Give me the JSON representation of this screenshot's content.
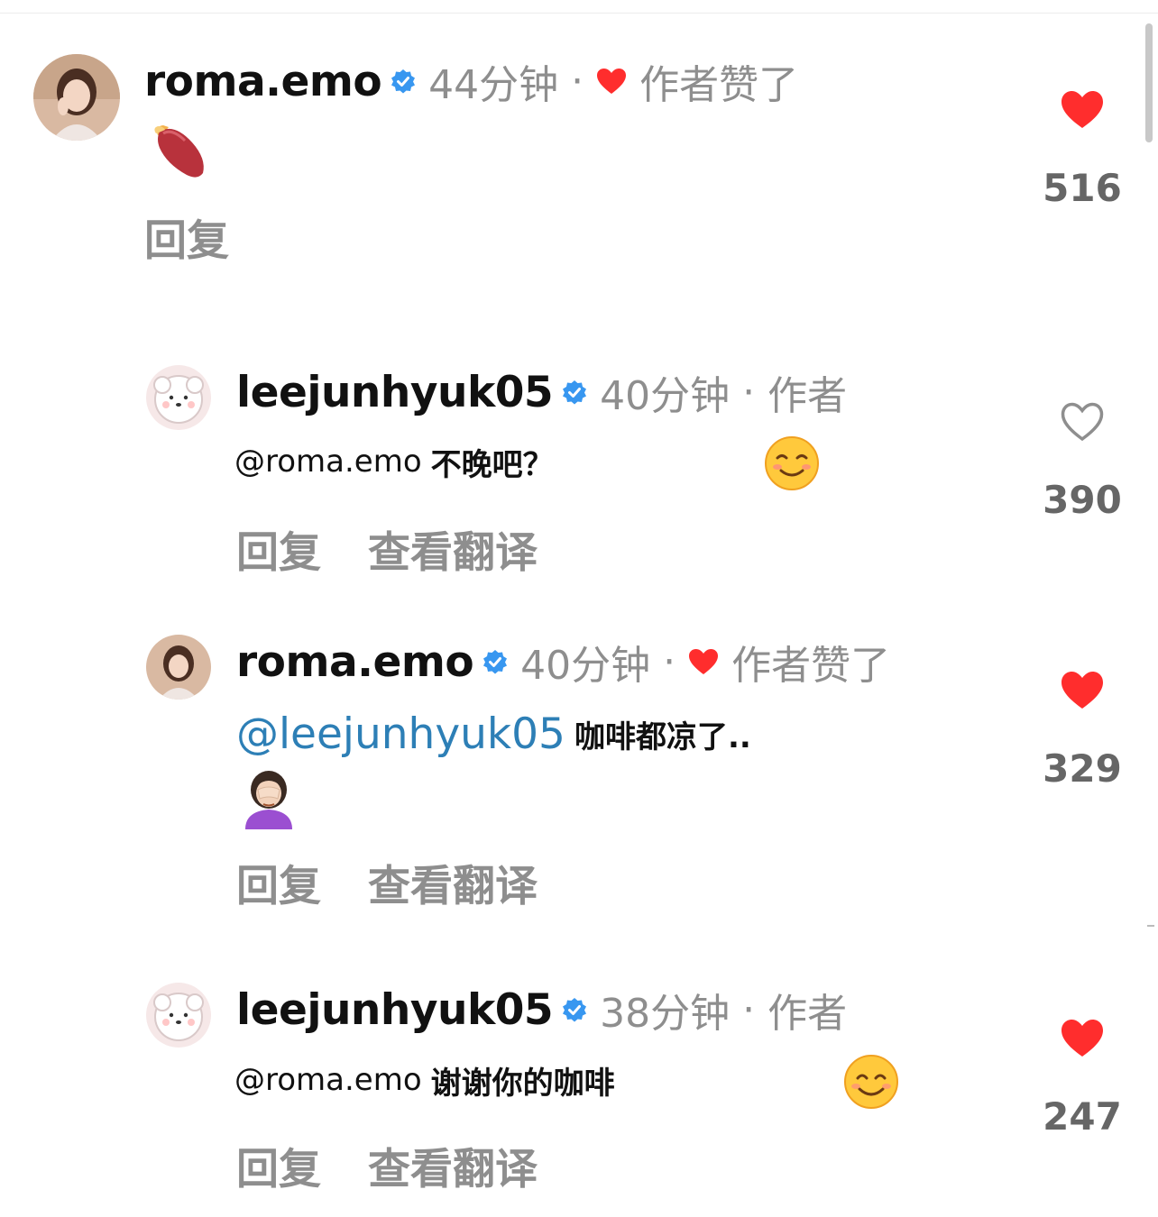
{
  "comments": [
    {
      "username": "roma.emo",
      "time": "44分钟",
      "separator": "·",
      "badge": "作者赞了",
      "body_emoji": "sweet-potato",
      "actions": [
        "回复"
      ],
      "like_count": "516",
      "liked": true
    },
    {
      "username": "leejunhyuk05",
      "time": "40分钟",
      "separator": "·",
      "badge": "作者",
      "mention": "@roma.emo",
      "text": "不晚吧？",
      "body_emoji": "smiling-face",
      "actions": [
        "回复",
        "查看翻译"
      ],
      "like_count": "390",
      "liked": false
    },
    {
      "username": "roma.emo",
      "time": "40分钟",
      "separator": "·",
      "badge": "作者赞了",
      "mention": "@leejunhyuk05",
      "text": "咖啡都凉了..",
      "body_emoji": "woman-facepalming",
      "actions": [
        "回复",
        "查看翻译"
      ],
      "like_count": "329",
      "liked": true
    },
    {
      "username": "leejunhyuk05",
      "time": "38分钟",
      "separator": "·",
      "badge": "作者",
      "mention": "@roma.emo",
      "text": "谢谢你的咖啡",
      "body_emoji": "smiling-face-with-smiling-eyes",
      "actions": [
        "回复",
        "查看翻译"
      ],
      "like_count": "247",
      "liked": true
    }
  ],
  "colors": {
    "like_red": "#ff2d2d",
    "verified_blue": "#3897f0",
    "secondary_text": "#8e8e8e",
    "mention_blue": "#2d7fb6"
  }
}
